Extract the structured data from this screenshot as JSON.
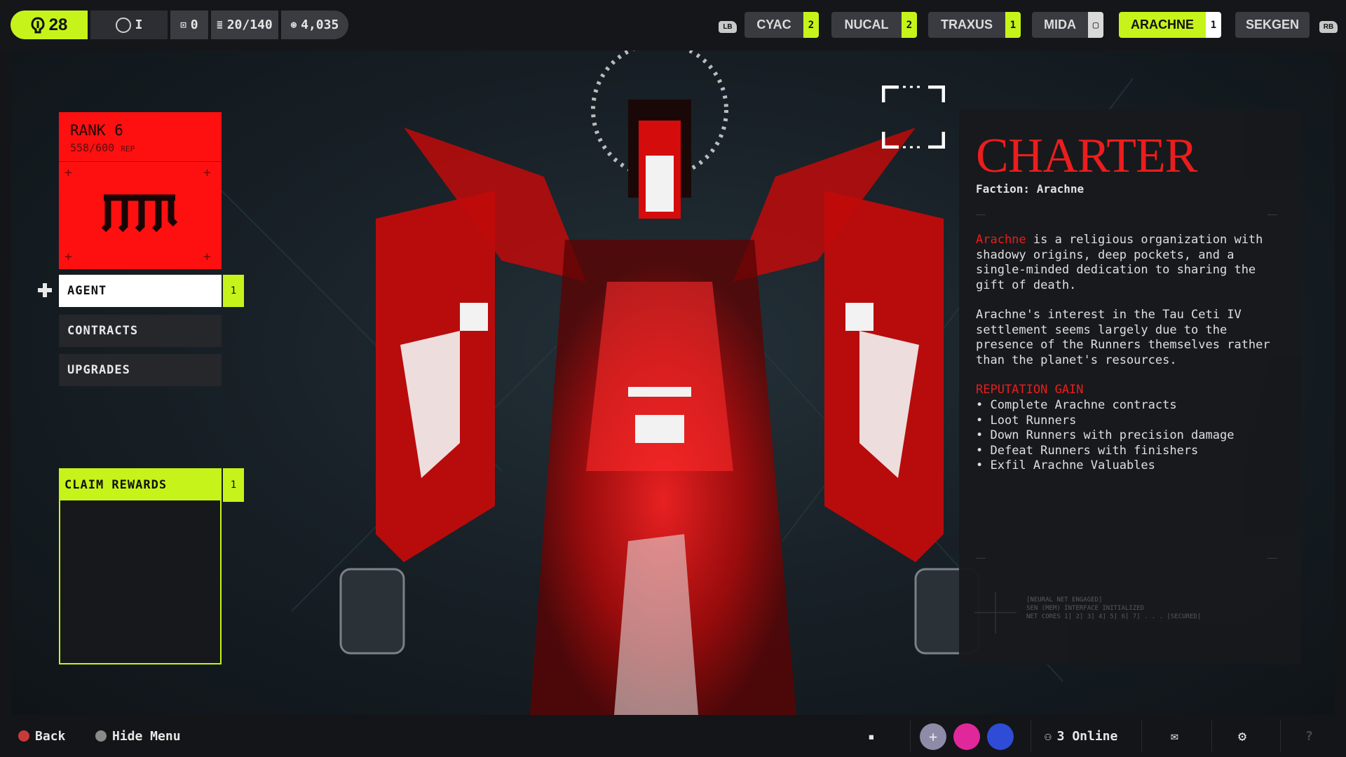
{
  "topbar": {
    "level": "28",
    "avatar_tier": "I",
    "stat_a": "0",
    "stat_b": "20/140",
    "stat_c": "4,035",
    "bumper_left": "LB",
    "bumper_right": "RB",
    "factions": [
      {
        "name": "CYAC",
        "count": "2"
      },
      {
        "name": "NUCAL",
        "count": "2"
      },
      {
        "name": "TRAXUS",
        "count": "1"
      },
      {
        "name": "MIDA",
        "count": ""
      },
      {
        "name": "ARACHNE",
        "count": "1"
      },
      {
        "name": "SEKGEN",
        "count": ""
      }
    ]
  },
  "rank": {
    "title": "RANK 6",
    "rep": "558/600",
    "rep_unit": "REP"
  },
  "menu": {
    "items": [
      {
        "label": "AGENT",
        "badge": "1"
      },
      {
        "label": "CONTRACTS"
      },
      {
        "label": "UPGRADES"
      }
    ],
    "claim_label": "CLAIM REWARDS",
    "claim_badge": "1"
  },
  "panel": {
    "title": "CHARTER",
    "subtitle": "Faction: Arachne",
    "para1_highlight": "Arachne",
    "para1_rest": " is a religious organization with shadowy origins, deep pockets, and a single-minded dedication to sharing the gift of death.",
    "para2": "Arachne's interest in the Tau Ceti IV settlement seems largely due to the presence of the Runners themselves rather than the planet's resources.",
    "heading": "REPUTATION GAIN",
    "bullets": [
      "Complete Arachne contracts",
      "Loot Runners",
      "Down Runners with precision damage",
      "Defeat Runners with finishers",
      "Exfil Arachne Valuables"
    ],
    "footer_lines": [
      "[NEURAL NET ENGAGED]",
      "SEN (MEM) INTERFACE INITIALIZED",
      "NET CORES 1] 2] 3] 4] 5] 6] 7] . . . [SECURED]"
    ]
  },
  "bottombar": {
    "back": "Back",
    "hide_menu": "Hide Menu",
    "online": "3 Online"
  },
  "colors": {
    "accent": "#c6f41a",
    "faction_red": "#fe1010",
    "panel_bg": "#18191c"
  }
}
